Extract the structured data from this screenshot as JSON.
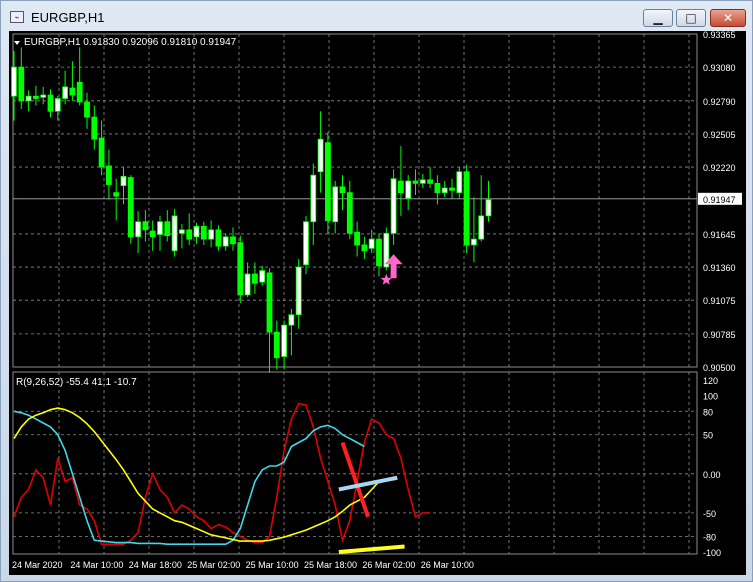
{
  "window": {
    "title": "EURGBP,H1",
    "icon_name": "chart-window-icon",
    "buttons": {
      "minimize": "▁",
      "maximize": "□",
      "close": "✕"
    }
  },
  "colors": {
    "background": "#000000",
    "grid": "#8c8c8c",
    "text": "#ffffff",
    "bull_candle": "#ffffff",
    "bear_candle": "#00ff00",
    "wick": "#00ff00",
    "bid_line": "#b0b0b0",
    "arrow": "#ff66cc",
    "line_red": "#e00000",
    "line_cyan": "#3fd8e8",
    "line_yellow": "#ffff00",
    "trend_red": "#ff2020",
    "trend_lightblue": "#a8d8f0",
    "trend_yellow": "#ffff20"
  },
  "chart_data": [
    {
      "type": "candlestick",
      "title": "EURGBP,H1  0.91830 0.92096 0.91810 0.91947",
      "symbol": "EURGBP,H1",
      "ohlc_header": "0.91830 0.92096 0.91810 0.91947",
      "current_price": "0.91947",
      "price_ticks": [
        "0.93365",
        "0.93080",
        "0.92790",
        "0.92505",
        "0.92220",
        "0.91645",
        "0.91360",
        "0.91075",
        "0.90785",
        "0.90500"
      ],
      "ylim": [
        0.905,
        0.93365
      ],
      "grid": true,
      "candles": [
        {
          "o": 0.9283,
          "h": 0.9322,
          "l": 0.9262,
          "c": 0.9308
        },
        {
          "o": 0.9308,
          "h": 0.9325,
          "l": 0.9272,
          "c": 0.9279
        },
        {
          "o": 0.9279,
          "h": 0.9288,
          "l": 0.927,
          "c": 0.9283
        },
        {
          "o": 0.9283,
          "h": 0.9292,
          "l": 0.9275,
          "c": 0.9281
        },
        {
          "o": 0.9282,
          "h": 0.9291,
          "l": 0.9276,
          "c": 0.9284
        },
        {
          "o": 0.9284,
          "h": 0.9289,
          "l": 0.9265,
          "c": 0.927
        },
        {
          "o": 0.927,
          "h": 0.9283,
          "l": 0.9262,
          "c": 0.9281
        },
        {
          "o": 0.9281,
          "h": 0.9305,
          "l": 0.9276,
          "c": 0.9291
        },
        {
          "o": 0.929,
          "h": 0.9313,
          "l": 0.9279,
          "c": 0.9284
        },
        {
          "o": 0.9295,
          "h": 0.9325,
          "l": 0.9275,
          "c": 0.9278
        },
        {
          "o": 0.9278,
          "h": 0.9286,
          "l": 0.9255,
          "c": 0.9265
        },
        {
          "o": 0.9265,
          "h": 0.9275,
          "l": 0.9237,
          "c": 0.9246
        },
        {
          "o": 0.9247,
          "h": 0.9262,
          "l": 0.9215,
          "c": 0.9222
        },
        {
          "o": 0.9223,
          "h": 0.9237,
          "l": 0.9194,
          "c": 0.9207
        },
        {
          "o": 0.92,
          "h": 0.9212,
          "l": 0.9176,
          "c": 0.9197
        },
        {
          "o": 0.9206,
          "h": 0.9222,
          "l": 0.919,
          "c": 0.9214
        },
        {
          "o": 0.9213,
          "h": 0.9215,
          "l": 0.9156,
          "c": 0.9162
        },
        {
          "o": 0.9162,
          "h": 0.9184,
          "l": 0.9148,
          "c": 0.9175
        },
        {
          "o": 0.9175,
          "h": 0.9185,
          "l": 0.9158,
          "c": 0.9168
        },
        {
          "o": 0.9167,
          "h": 0.9176,
          "l": 0.915,
          "c": 0.9162
        },
        {
          "o": 0.9164,
          "h": 0.918,
          "l": 0.915,
          "c": 0.9175
        },
        {
          "o": 0.9175,
          "h": 0.9185,
          "l": 0.9158,
          "c": 0.9163
        },
        {
          "o": 0.915,
          "h": 0.9186,
          "l": 0.9145,
          "c": 0.918
        },
        {
          "o": 0.9165,
          "h": 0.9173,
          "l": 0.9152,
          "c": 0.9168
        },
        {
          "o": 0.9168,
          "h": 0.9182,
          "l": 0.9155,
          "c": 0.916
        },
        {
          "o": 0.9162,
          "h": 0.9174,
          "l": 0.9156,
          "c": 0.9171
        },
        {
          "o": 0.9171,
          "h": 0.9175,
          "l": 0.9155,
          "c": 0.916
        },
        {
          "o": 0.916,
          "h": 0.9176,
          "l": 0.9153,
          "c": 0.9168
        },
        {
          "o": 0.9168,
          "h": 0.9172,
          "l": 0.915,
          "c": 0.9154
        },
        {
          "o": 0.9154,
          "h": 0.9165,
          "l": 0.915,
          "c": 0.9162
        },
        {
          "o": 0.9162,
          "h": 0.917,
          "l": 0.915,
          "c": 0.9156
        },
        {
          "o": 0.9157,
          "h": 0.9163,
          "l": 0.9105,
          "c": 0.9112
        },
        {
          "o": 0.9112,
          "h": 0.914,
          "l": 0.911,
          "c": 0.913
        },
        {
          "o": 0.913,
          "h": 0.914,
          "l": 0.9113,
          "c": 0.9122
        },
        {
          "o": 0.9123,
          "h": 0.9137,
          "l": 0.912,
          "c": 0.9133
        },
        {
          "o": 0.9131,
          "h": 0.9135,
          "l": 0.9045,
          "c": 0.908
        },
        {
          "o": 0.908,
          "h": 0.909,
          "l": 0.9048,
          "c": 0.9058
        },
        {
          "o": 0.9059,
          "h": 0.909,
          "l": 0.9048,
          "c": 0.9086
        },
        {
          "o": 0.9086,
          "h": 0.91,
          "l": 0.906,
          "c": 0.9095
        },
        {
          "o": 0.9095,
          "h": 0.9143,
          "l": 0.9083,
          "c": 0.9136
        },
        {
          "o": 0.9138,
          "h": 0.918,
          "l": 0.913,
          "c": 0.9175
        },
        {
          "o": 0.9175,
          "h": 0.9225,
          "l": 0.9155,
          "c": 0.9215
        },
        {
          "o": 0.9218,
          "h": 0.927,
          "l": 0.92,
          "c": 0.9246
        },
        {
          "o": 0.9243,
          "h": 0.9252,
          "l": 0.9165,
          "c": 0.9176
        },
        {
          "o": 0.9175,
          "h": 0.921,
          "l": 0.9165,
          "c": 0.9205
        },
        {
          "o": 0.9205,
          "h": 0.9215,
          "l": 0.9185,
          "c": 0.92
        },
        {
          "o": 0.92,
          "h": 0.921,
          "l": 0.916,
          "c": 0.9165
        },
        {
          "o": 0.9166,
          "h": 0.9175,
          "l": 0.9145,
          "c": 0.9155
        },
        {
          "o": 0.9155,
          "h": 0.9162,
          "l": 0.9143,
          "c": 0.915
        },
        {
          "o": 0.9152,
          "h": 0.9168,
          "l": 0.9148,
          "c": 0.916
        },
        {
          "o": 0.916,
          "h": 0.9165,
          "l": 0.9128,
          "c": 0.9137
        },
        {
          "o": 0.9136,
          "h": 0.917,
          "l": 0.9133,
          "c": 0.9165
        },
        {
          "o": 0.9165,
          "h": 0.922,
          "l": 0.9155,
          "c": 0.9212
        },
        {
          "o": 0.921,
          "h": 0.924,
          "l": 0.918,
          "c": 0.92
        },
        {
          "o": 0.9195,
          "h": 0.9215,
          "l": 0.9185,
          "c": 0.921
        },
        {
          "o": 0.921,
          "h": 0.922,
          "l": 0.9198,
          "c": 0.9208
        },
        {
          "o": 0.9208,
          "h": 0.9216,
          "l": 0.9204,
          "c": 0.9211
        },
        {
          "o": 0.9211,
          "h": 0.9222,
          "l": 0.9204,
          "c": 0.9208
        },
        {
          "o": 0.9208,
          "h": 0.9215,
          "l": 0.919,
          "c": 0.92
        },
        {
          "o": 0.92,
          "h": 0.921,
          "l": 0.9196,
          "c": 0.9204
        },
        {
          "o": 0.9204,
          "h": 0.9212,
          "l": 0.9195,
          "c": 0.9202
        },
        {
          "o": 0.92,
          "h": 0.9222,
          "l": 0.9195,
          "c": 0.9218
        },
        {
          "o": 0.9218,
          "h": 0.9224,
          "l": 0.9148,
          "c": 0.9155
        },
        {
          "o": 0.9155,
          "h": 0.9196,
          "l": 0.914,
          "c": 0.916
        },
        {
          "o": 0.916,
          "h": 0.9215,
          "l": 0.9158,
          "c": 0.918
        },
        {
          "o": 0.918,
          "h": 0.921,
          "l": 0.9175,
          "c": 0.9194
        }
      ],
      "arrow_marker": {
        "bar_index": 52,
        "price": 0.9135,
        "label": "up-arrow-icon"
      },
      "star_marker": {
        "bar_index": 51,
        "price": 0.9125,
        "label": "star-icon"
      }
    },
    {
      "type": "line",
      "title": "R(9,26,52) -55.4 41.1 -10.7",
      "y_ticks": [
        "120",
        "100",
        "80",
        "50",
        "0.00",
        "-50",
        "-80",
        "-100"
      ],
      "y_tick_values": [
        120,
        100,
        80,
        50,
        0,
        -50,
        -80,
        -100
      ],
      "ylim": [
        -100,
        120
      ],
      "x_ticks": [
        "24 Mar 2020",
        "24 Mar 10:00",
        "24 Mar 18:00",
        "25 Mar 02:00",
        "25 Mar 10:00",
        "25 Mar 18:00",
        "26 Mar 02:00",
        "26 Mar 10:00"
      ],
      "x_tick_bars": [
        0,
        8,
        16,
        24,
        32,
        40,
        48,
        56
      ],
      "grid": true,
      "series": [
        {
          "color": "#e00000",
          "values": [
            -55,
            -30,
            -20,
            5,
            -5,
            -40,
            20,
            -10,
            -5,
            -40,
            -45,
            -60,
            -90,
            -90,
            -90,
            -90,
            -85,
            -75,
            -30,
            0,
            -20,
            -30,
            -50,
            -40,
            -45,
            -55,
            -60,
            -70,
            -65,
            -68,
            -75,
            -80,
            -85,
            -88,
            -88,
            -80,
            -30,
            30,
            70,
            90,
            88,
            60,
            20,
            -10,
            -40,
            -85,
            -60,
            -10,
            40,
            70,
            65,
            50,
            45,
            20,
            -20,
            -55,
            -50,
            -50
          ]
        },
        {
          "color": "#3fd8e8",
          "values": [
            80,
            78,
            75,
            70,
            65,
            60,
            50,
            30,
            0,
            -30,
            -60,
            -85,
            -86,
            -87,
            -88,
            -88,
            -88,
            -89,
            -89,
            -89,
            -89,
            -90,
            -90,
            -90,
            -90,
            -90,
            -90,
            -90,
            -90,
            -90,
            -85,
            -70,
            -40,
            -10,
            5,
            10,
            10,
            15,
            35,
            40,
            45,
            55,
            60,
            62,
            58,
            50,
            45,
            40,
            35
          ]
        },
        {
          "color": "#ffff00",
          "values": [
            45,
            60,
            70,
            75,
            78,
            82,
            84,
            82,
            78,
            72,
            64,
            54,
            42,
            30,
            18,
            5,
            -10,
            -25,
            -35,
            -45,
            -50,
            -55,
            -60,
            -62,
            -66,
            -70,
            -74,
            -78,
            -80,
            -82,
            -84,
            -86,
            -86,
            -86,
            -86,
            -85,
            -83,
            -81,
            -78,
            -75,
            -72,
            -68,
            -64,
            -60,
            -55,
            -48,
            -40,
            -35,
            -30,
            -20,
            -10
          ]
        }
      ]
    }
  ],
  "drawings": [
    {
      "name": "red-trendline",
      "color": "#ff2020"
    },
    {
      "name": "lightblue-trendline",
      "color": "#a8d8f0"
    },
    {
      "name": "yellow-trendline",
      "color": "#ffff20"
    }
  ]
}
